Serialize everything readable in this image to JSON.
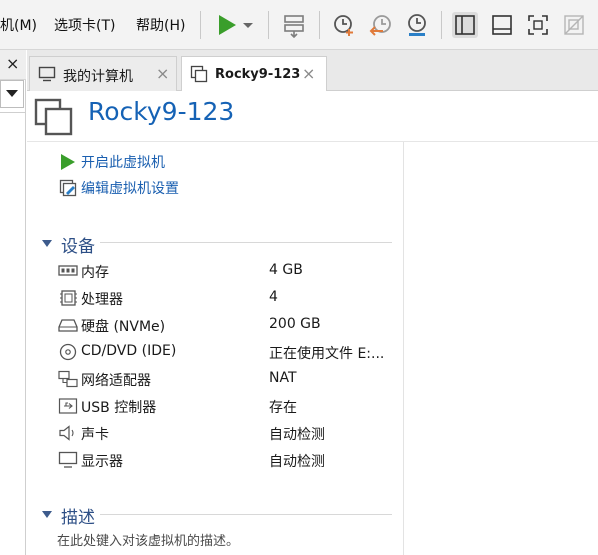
{
  "menu": {
    "items": [
      {
        "label": "机(M)"
      },
      {
        "label": "选项卡(T)"
      },
      {
        "label": "帮助(H)"
      }
    ]
  },
  "toolbar": {
    "icons": [
      "play-icon",
      "dropdown-arrow-icon",
      "send-ctrl-alt-del-icon",
      "snapshot-take-icon",
      "snapshot-revert-icon",
      "snapshot-manager-icon",
      "view-library-icon",
      "view-thumbnail-icon",
      "fullscreen-icon",
      "unity-icon"
    ],
    "colors": {
      "play": "#3a9e2b",
      "snapshot_accent": "#e07a3a"
    }
  },
  "sidebar": {
    "close_glyph": "×"
  },
  "tabs": [
    {
      "label": "我的计算机",
      "close": "×",
      "active": false
    },
    {
      "label": "Rocky9-123",
      "close": "×",
      "active": true
    }
  ],
  "vm": {
    "title": "Rocky9-123",
    "title_color": "#1562b5"
  },
  "actions": [
    {
      "label": "开启此虚拟机",
      "icon": "play-icon"
    },
    {
      "label": "编辑虚拟机设置",
      "icon": "edit-settings-icon"
    }
  ],
  "sections": {
    "devices": "设备",
    "description": "描述"
  },
  "devices": [
    {
      "name": "内存",
      "value": "4 GB",
      "icon": "memory-icon"
    },
    {
      "name": "处理器",
      "value": "4",
      "icon": "cpu-icon"
    },
    {
      "name": "硬盘 (NVMe)",
      "value": "200 GB",
      "icon": "harddisk-icon"
    },
    {
      "name": "CD/DVD (IDE)",
      "value": "正在使用文件 E:...",
      "icon": "cd-dvd-icon"
    },
    {
      "name": "网络适配器",
      "value": "NAT",
      "icon": "network-icon"
    },
    {
      "name": "USB 控制器",
      "value": "存在",
      "icon": "usb-icon"
    },
    {
      "name": "声卡",
      "value": "自动检测",
      "icon": "sound-icon"
    },
    {
      "name": "显示器",
      "value": "自动检测",
      "icon": "display-icon"
    }
  ],
  "description": {
    "placeholder": "在此处键入对该虚拟机的描述。"
  }
}
